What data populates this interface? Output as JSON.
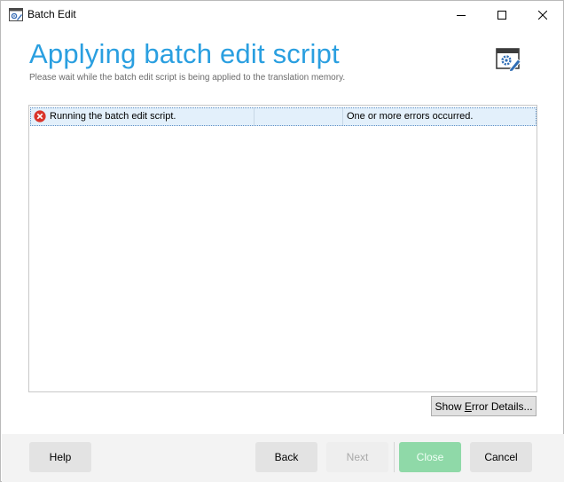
{
  "window": {
    "title": "Batch Edit",
    "app_icon": "batch-edit-app-icon",
    "controls": {
      "minimize": "minimize-icon",
      "maximize": "maximize-icon",
      "close": "close-icon"
    }
  },
  "header": {
    "title": "Applying batch edit script",
    "subtitle": "Please wait while the batch edit script is being applied to the translation memory.",
    "icon": "batch-edit-settings-icon",
    "accent_color": "#2a9fe0"
  },
  "task_list": {
    "rows": [
      {
        "status_icon": "error-icon",
        "status_color": "#d9342b",
        "task": "Running the batch edit script.",
        "progress": "",
        "message": "One or more errors occurred."
      }
    ]
  },
  "buttons": {
    "show_error_details": "Show Error Details...",
    "help": "Help",
    "back": "Back",
    "next": "Next",
    "close": "Close",
    "cancel": "Cancel"
  }
}
